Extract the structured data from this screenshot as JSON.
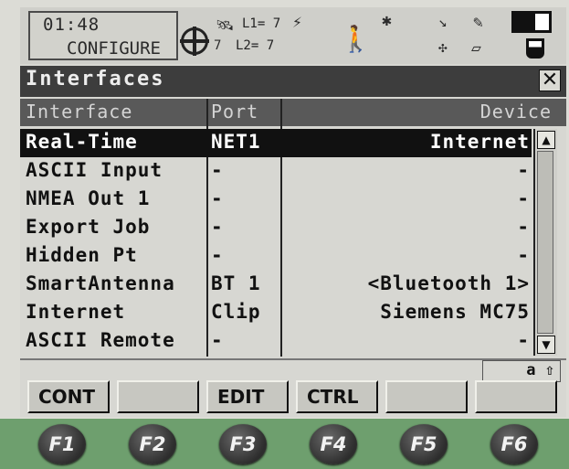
{
  "status": {
    "time": "01:48",
    "mode": "CONFIGURE",
    "l1_label": "L1= 7",
    "l2_label": "L2= 7",
    "sat_count": "7"
  },
  "dialog": {
    "title": "Interfaces",
    "close_glyph": "✕"
  },
  "table": {
    "headers": [
      "Interface",
      "Port",
      "Device"
    ],
    "rows": [
      {
        "interface": "Real-Time",
        "port": "NET1",
        "device": "Internet",
        "selected": true
      },
      {
        "interface": "ASCII Input",
        "port": "-",
        "device": "-"
      },
      {
        "interface": "NMEA Out 1",
        "port": "-",
        "device": "-"
      },
      {
        "interface": "Export Job",
        "port": "-",
        "device": "-"
      },
      {
        "interface": "Hidden Pt",
        "port": "-",
        "device": "-"
      },
      {
        "interface": "SmartAntenna",
        "port": "BT 1",
        "device": "<Bluetooth 1>"
      },
      {
        "interface": "Internet",
        "port": "Clip",
        "device": "Siemens MC75"
      },
      {
        "interface": "ASCII Remote",
        "port": "-",
        "device": "-"
      }
    ]
  },
  "input_mode": "a ⇧",
  "softkeys": [
    "CONT",
    "",
    "EDIT",
    "CTRL",
    "",
    ""
  ],
  "hardware_keys": [
    "F1",
    "F2",
    "F3",
    "F4",
    "F5",
    "F6"
  ],
  "colors": {
    "title_bar": "#3d3d3d",
    "header_bar": "#595959",
    "selection": "#111111",
    "fkey_strip": "#6e9f6e"
  }
}
